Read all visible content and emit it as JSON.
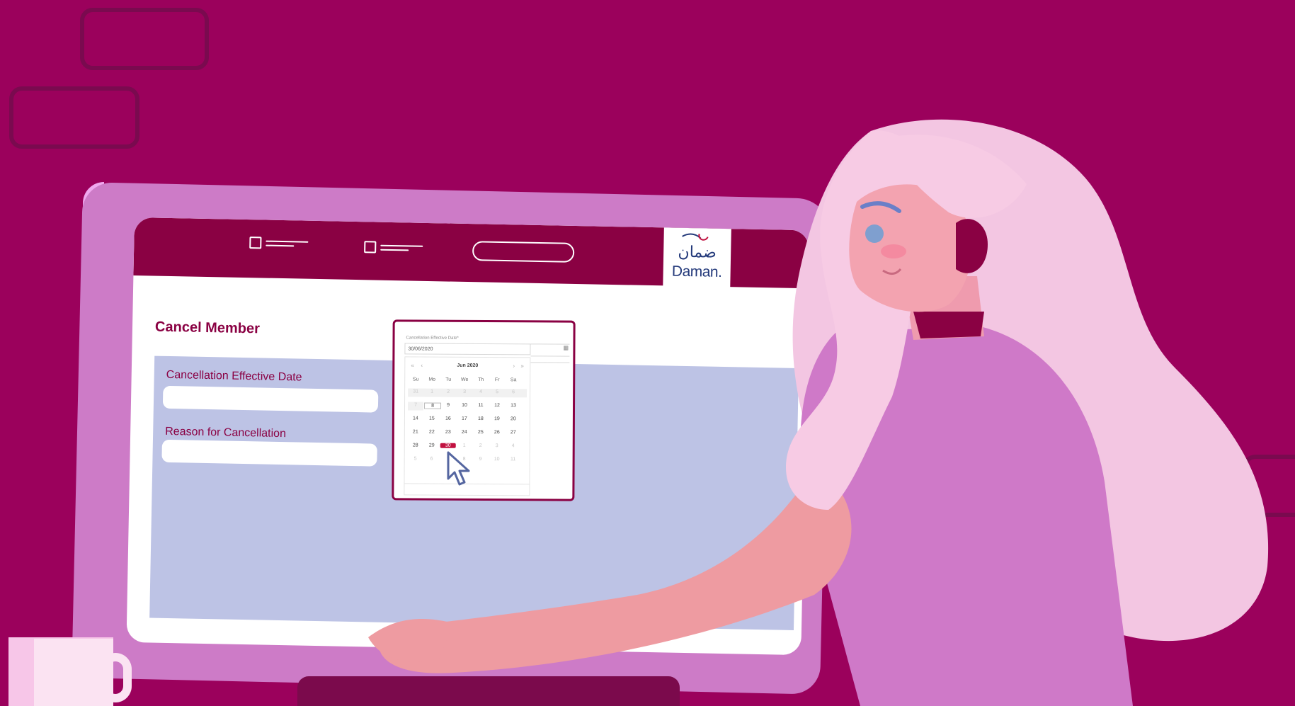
{
  "app": {
    "brand_arabic": "ضمان",
    "brand_latin": "Daman.",
    "page_title": "Cancel Member"
  },
  "form": {
    "cancellation_date_label": "Cancellation Effective Date",
    "cancellation_date_value": "",
    "reason_label": "Reason for Cancellation",
    "reason_value": ""
  },
  "datepicker": {
    "field_label": "Cancellation Effective Date*",
    "input_value": "30/06/2020",
    "month_label": "Jun 2020",
    "nav_prev_year": "«",
    "nav_prev_month": "‹",
    "nav_next_month": "›",
    "nav_next_year": "»",
    "calendar_icon": "calendar-icon",
    "weekdays": [
      "Su",
      "Mo",
      "Tu",
      "We",
      "Th",
      "Fr",
      "Sa"
    ],
    "weeks": [
      [
        "31",
        "1",
        "2",
        "3",
        "4",
        "5",
        "6"
      ],
      [
        "7",
        "8",
        "9",
        "10",
        "11",
        "12",
        "13"
      ],
      [
        "14",
        "15",
        "16",
        "17",
        "18",
        "19",
        "20"
      ],
      [
        "21",
        "22",
        "23",
        "24",
        "25",
        "26",
        "27"
      ],
      [
        "28",
        "29",
        "30",
        "1",
        "2",
        "3",
        "4"
      ],
      [
        "5",
        "6",
        "7",
        "8",
        "9",
        "10",
        "11"
      ]
    ],
    "selected_day": "30",
    "today_day": "8"
  },
  "colors": {
    "background": "#9b015c",
    "brand_maroon": "#8a0143",
    "panel": "#bdc3e5",
    "monitor": "#cd7bc7",
    "selected": "#c11140",
    "logo_blue": "#23397a"
  }
}
